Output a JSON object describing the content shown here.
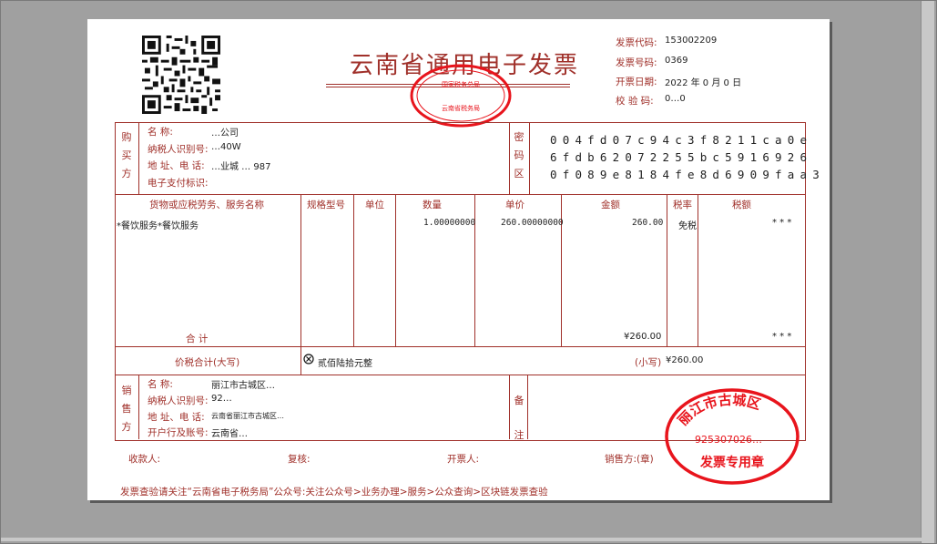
{
  "invoice": {
    "title": "云南省通用电子发票",
    "meta": {
      "code_label": "发票代码:",
      "code_value": "153002209",
      "number_label": "发票号码:",
      "number_value": "0369",
      "date_label": "开票日期:",
      "date_value": "2022 年 0 月 0 日",
      "check_label": "校 验 码:",
      "check_value": "0…0"
    },
    "buyer": {
      "section_label": "购买方",
      "name_label": "名 称:",
      "name_value": "…公司",
      "taxid_label": "纳税人识别号:",
      "taxid_value": "…40W",
      "addr_label": "地 址、电 话:",
      "addr_value": "…业城 … 987",
      "epay_label": "电子支付标识:"
    },
    "cipher": {
      "section_label": "密码区",
      "lines": [
        "004fd07c94c3f8211ca0e",
        "6fdb62072255bc5916926",
        "0f089e8184fe8d6909faa3"
      ]
    },
    "items": {
      "headers": [
        "货物或应税劳务、服务名称",
        "规格型号",
        "单位",
        "数量",
        "单价",
        "金额",
        "税率",
        "税额"
      ],
      "rows": [
        {
          "name": "*餐饮服务*餐饮服务",
          "spec": "",
          "unit": "",
          "qty": "1.00000000",
          "price": "260.00000000",
          "amount": "260.00",
          "rate": "免税",
          "tax": "* * *"
        }
      ],
      "sum_label": "合 计",
      "sum_amount": "¥260.00",
      "sum_tax": "* * *"
    },
    "total": {
      "label": "价税合计(大写)",
      "upper_value": "贰佰陆拾元整",
      "lower_label": "(小写)",
      "lower_value": "¥260.00"
    },
    "seller": {
      "section_label": "销售方",
      "name_label": "名 称:",
      "name_value": "丽江市古城区…",
      "taxid_label": "纳税人识别号:",
      "taxid_value": "92…",
      "addr_label": "地 址、电 话:",
      "addr_value": "云南省丽江市古城区…",
      "bank_label": "开户行及账号:",
      "bank_value": "云南省…",
      "remark_label": "备注"
    },
    "signatures": {
      "payee_label": "收款人:",
      "reviewer_label": "复核:",
      "drawer_label": "开票人:",
      "seller_label": "销售方:(章)"
    },
    "footer_note": "发票查验请关注“云南省电子税务局”公众号:关注公众号>业务办理>服务>公众查询>区块链发票查验",
    "stamp_tax": {
      "top_text": "国家税务总局",
      "bottom_text": "云南省税务局"
    },
    "stamp_seller": {
      "arc_text": "丽江市古城区",
      "code": "925307026…",
      "label": "发票专用章"
    },
    "colors": {
      "ink": "#a0302a",
      "stamp": "#e8141c",
      "text": "#222222"
    }
  }
}
